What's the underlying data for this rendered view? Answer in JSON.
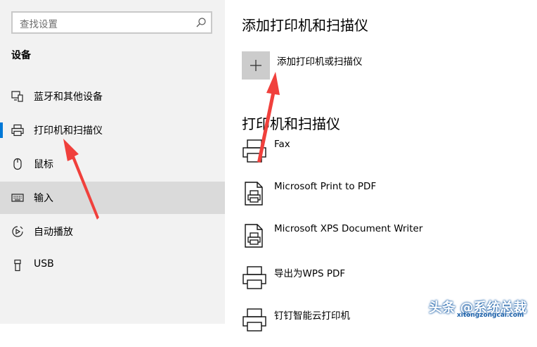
{
  "search": {
    "placeholder": "查找设置",
    "icon": "search-icon"
  },
  "sidebar": {
    "section_title": "设备",
    "items": [
      {
        "label": "蓝牙和其他设备",
        "icon": "bluetooth-devices-icon"
      },
      {
        "label": "打印机和扫描仪",
        "icon": "printer-icon",
        "selected": true
      },
      {
        "label": "鼠标",
        "icon": "mouse-icon"
      },
      {
        "label": "输入",
        "icon": "keyboard-icon"
      },
      {
        "label": "自动播放",
        "icon": "autoplay-icon"
      },
      {
        "label": "USB",
        "icon": "usb-icon"
      }
    ]
  },
  "main": {
    "add_heading": "添加打印机和扫描仪",
    "add_button_label": "添加打印机或扫描仪",
    "printers_heading": "打印机和扫描仪",
    "printers": [
      {
        "name": "Fax",
        "icon": "fax-printer-icon"
      },
      {
        "name": "Microsoft Print to PDF",
        "icon": "pdf-printer-icon"
      },
      {
        "name": "Microsoft XPS Document Writer",
        "icon": "xps-printer-icon"
      },
      {
        "name": "导出为WPS PDF",
        "icon": "printer-icon"
      },
      {
        "name": "钉钉智能云打印机",
        "icon": "printer-icon"
      }
    ]
  },
  "watermark": {
    "text": "头条 @系统总裁",
    "url": "xitongzongcai.com"
  },
  "colors": {
    "accent": "#0078d7",
    "annotation_arrow": "#f0403c",
    "sidebar_bg": "#f2f2f2"
  }
}
